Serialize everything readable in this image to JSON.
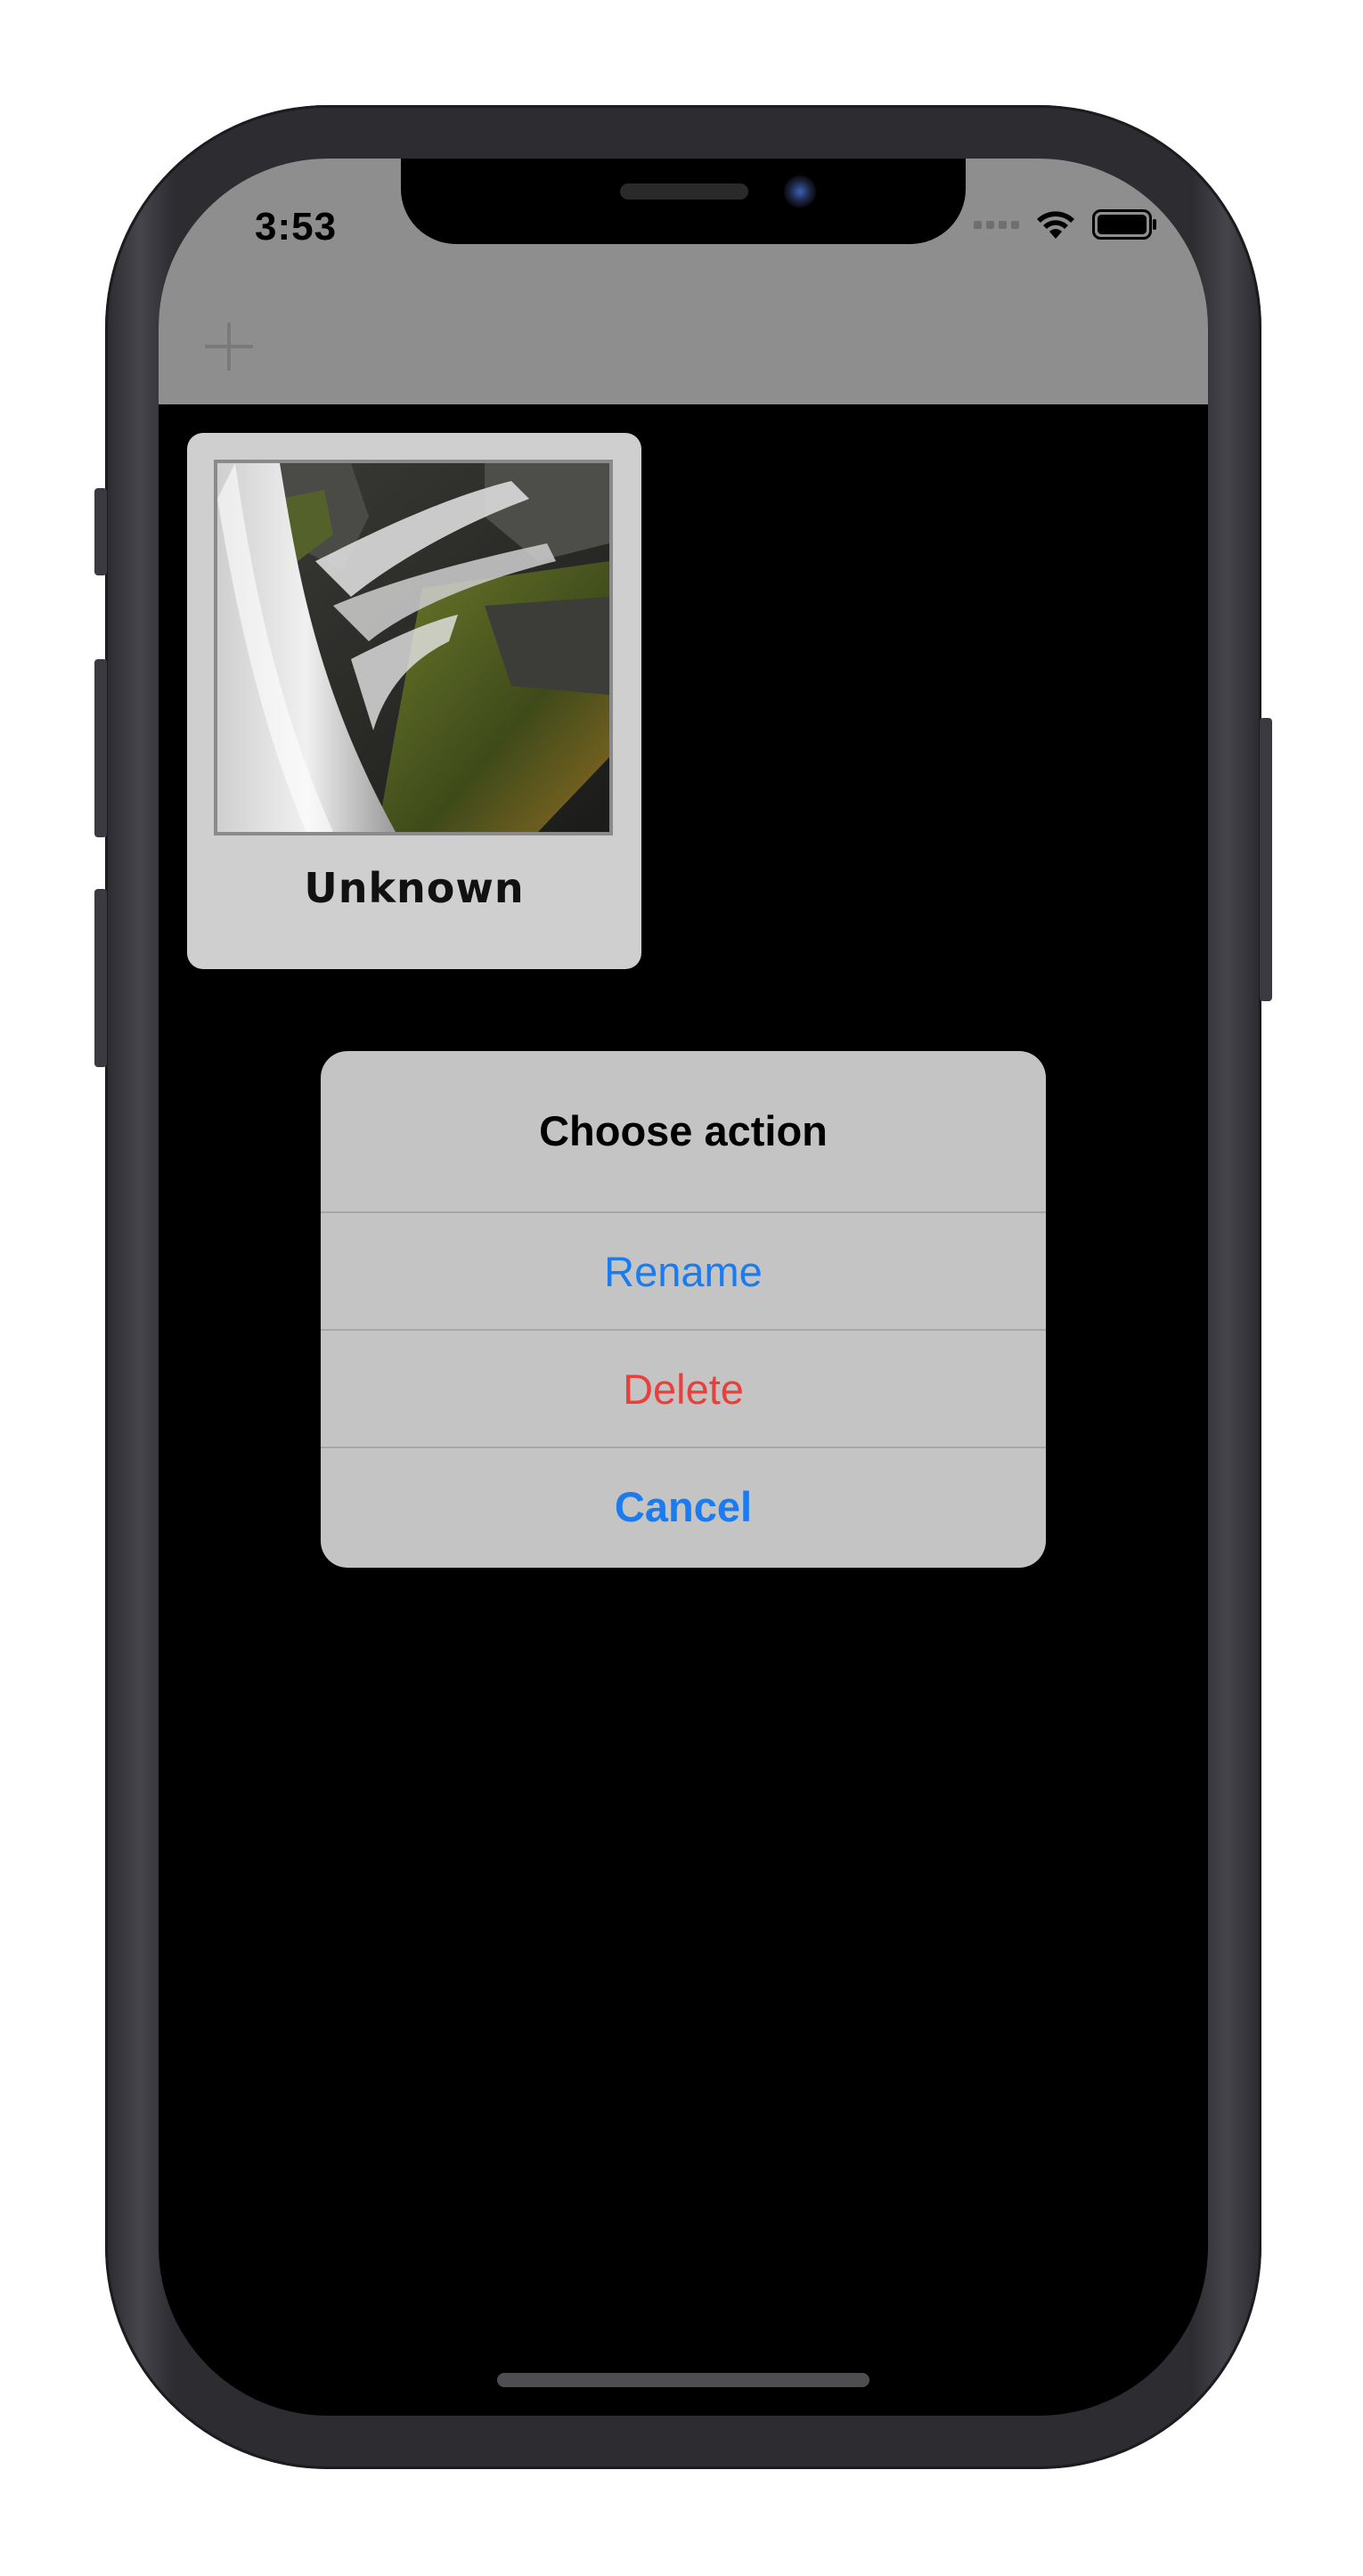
{
  "status_bar": {
    "time": "3:53",
    "signal_icon": "cellular-signal-icon",
    "wifi_icon": "wifi-icon",
    "battery_icon": "battery-icon"
  },
  "navbar": {
    "add_icon": "plus-icon",
    "background_color": "#8e8e8e"
  },
  "album_card": {
    "label": "Unknown",
    "thumbnail": "waterfall-photo"
  },
  "action_sheet": {
    "title": "Choose action",
    "buttons": [
      {
        "label": "Rename",
        "color": "#1a7cf0",
        "style": "default"
      },
      {
        "label": "Delete",
        "color": "#e8413b",
        "style": "destructive"
      },
      {
        "label": "Cancel",
        "color": "#1a7cf0",
        "style": "cancel"
      }
    ]
  },
  "colors": {
    "accent": "#1a7cf0",
    "destructive": "#e8413b",
    "sheet_background": "#c4c4c4",
    "screen_background": "#000000"
  }
}
